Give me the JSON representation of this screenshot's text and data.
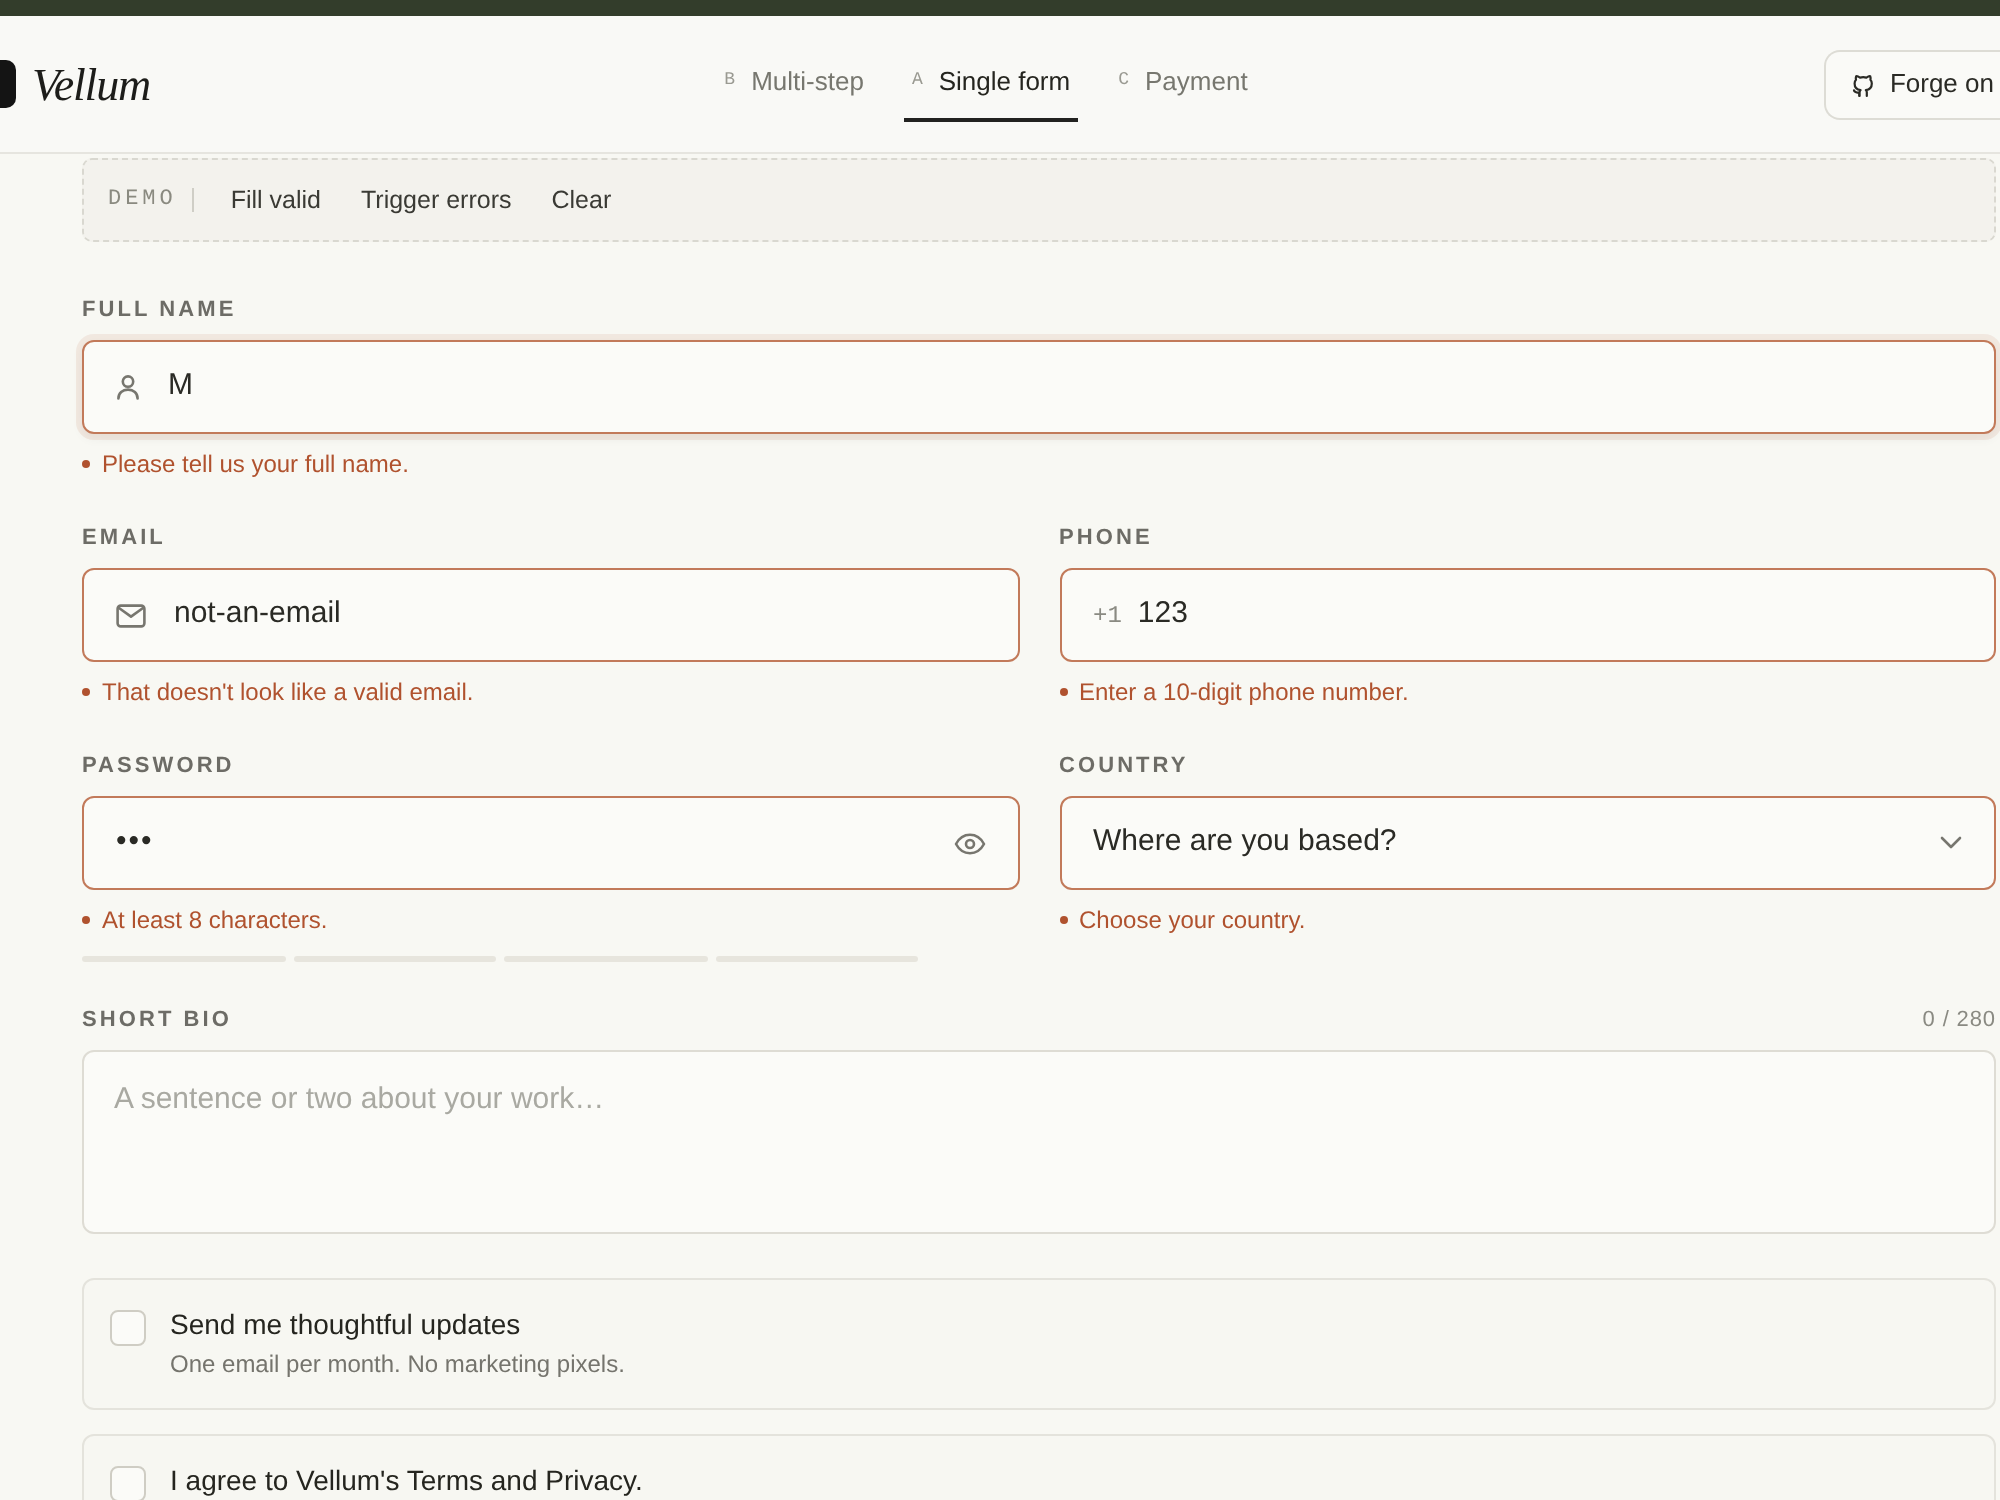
{
  "header": {
    "logo": "Vellum",
    "tabs": [
      {
        "key": "B",
        "label": "Multi-step",
        "selected": false
      },
      {
        "key": "A",
        "label": "Single form",
        "selected": true
      },
      {
        "key": "C",
        "label": "Payment",
        "selected": false
      }
    ],
    "repo_button": "Forge on"
  },
  "demo_bar": {
    "label": "DEMO",
    "actions": [
      "Fill valid",
      "Trigger errors",
      "Clear"
    ]
  },
  "form": {
    "rows": [
      {
        "fields": [
          {
            "kind": "name",
            "label": "FULL NAME",
            "value": "M",
            "focused": true,
            "error": "Please tell us your full name."
          }
        ]
      },
      {
        "fields": [
          {
            "kind": "email",
            "label": "EMAIL",
            "value": "not-an-email",
            "focused": false,
            "error": "That doesn't look like a valid email."
          },
          {
            "kind": "phone",
            "label": "PHONE",
            "prefix": "+1",
            "value": "123",
            "focused": false,
            "error": "Enter a 10-digit phone number."
          }
        ]
      },
      {
        "fields": [
          {
            "kind": "password",
            "label": "PASSWORD",
            "value": "•••",
            "focused": false,
            "error": "At least 8 characters.",
            "strength_bars": [
              {
                "lit": false
              },
              {
                "lit": false
              },
              {
                "lit": false
              },
              {
                "lit": false
              }
            ]
          },
          {
            "kind": "select",
            "label": "COUNTRY",
            "value": "Where are you based?",
            "focused": false,
            "error": "Choose your country."
          }
        ]
      },
      {
        "fields": [
          {
            "kind": "textarea",
            "label": "SHORT BIO",
            "counter": "0 / 280",
            "placeholder": "A sentence or two about your work…",
            "focused": false
          }
        ]
      }
    ],
    "options": [
      {
        "title": "Send me thoughtful updates",
        "description": "One email per month. No marketing pixels.",
        "checked": false
      },
      {
        "title": "I agree to Vellum's Terms and Privacy.",
        "checked": false
      }
    ]
  }
}
